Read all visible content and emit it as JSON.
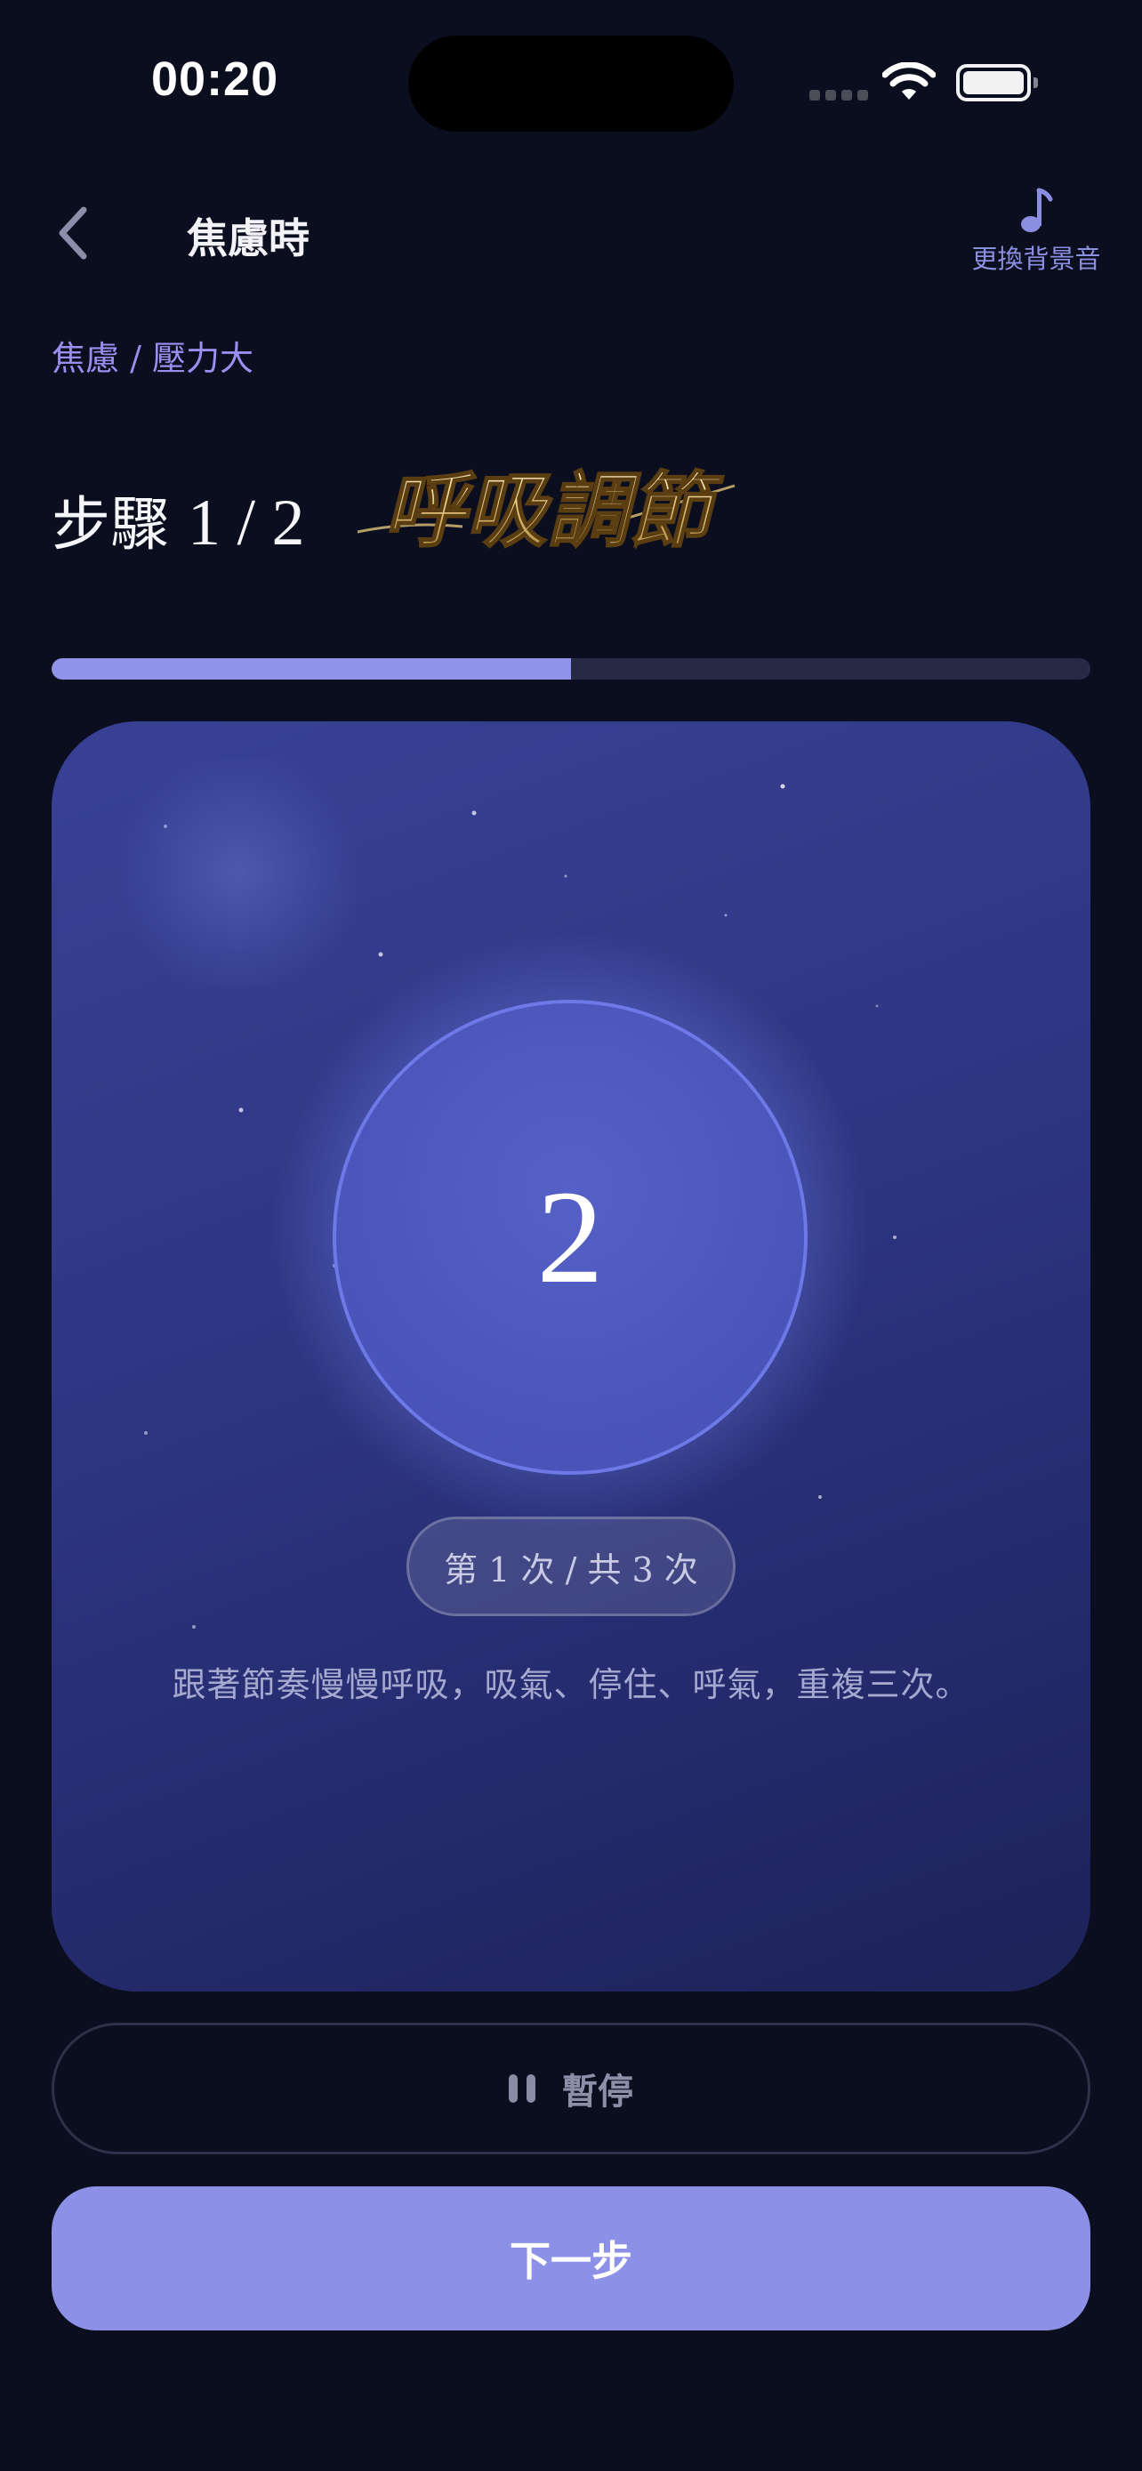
{
  "status_bar": {
    "time": "00:20"
  },
  "nav": {
    "title": "焦慮時",
    "music_label": "更換背景音"
  },
  "breadcrumb": "焦慮 / 壓力大",
  "step": {
    "prefix": "步驟",
    "counter": "1 / 2",
    "calligraphy_title": "呼吸調節",
    "progress_fraction": 0.5
  },
  "breathing": {
    "count": "2",
    "repeat": "第 1 次 / 共 3 次",
    "instruction": "跟著節奏慢慢呼吸，吸氣、停住、呼氣，重複三次。"
  },
  "buttons": {
    "pause_label": "暫停",
    "next_label": "下一步"
  },
  "colors": {
    "background": "#0b0e1e",
    "accent": "#8c90e6",
    "breadcrumb": "#9c8ef0",
    "gold": "#e0c27a"
  },
  "icons": {
    "back": "chevron-left-icon",
    "music": "music-note-icon",
    "pause": "pause-icon",
    "wifi": "wifi-icon",
    "battery": "battery-icon"
  }
}
